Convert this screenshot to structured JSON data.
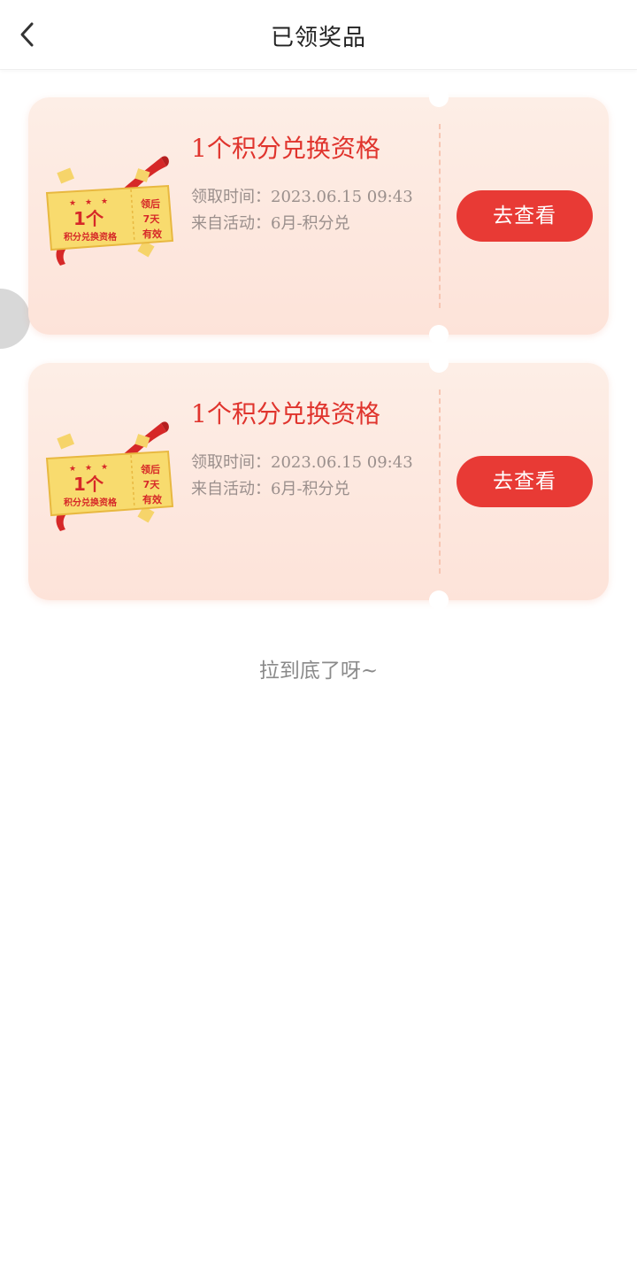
{
  "header": {
    "title": "已领奖品",
    "back_icon": "chevron-left-icon"
  },
  "prizes": [
    {
      "ticket_badge": {
        "count": "1个",
        "name": "积分兑换资格",
        "validity": [
          "领后",
          "7天",
          "有效"
        ]
      },
      "title": "1个积分兑换资格",
      "time_line": "领取时间：2023.06.15 09:43",
      "source_line": "来自活动：6月-积分兑",
      "button": "去查看"
    },
    {
      "ticket_badge": {
        "count": "1个",
        "name": "积分兑换资格",
        "validity": [
          "领后",
          "7天",
          "有效"
        ]
      },
      "title": "1个积分兑换资格",
      "time_line": "领取时间：2023.06.15 09:43",
      "source_line": "来自活动：6月-积分兑",
      "button": "去查看"
    }
  ],
  "footer": {
    "end_text": "拉到底了呀~"
  },
  "colors": {
    "accent": "#e83a35",
    "title_red": "#e0342d",
    "card_bg": "#fde9e0",
    "ticket_yellow": "#f8db6e"
  }
}
